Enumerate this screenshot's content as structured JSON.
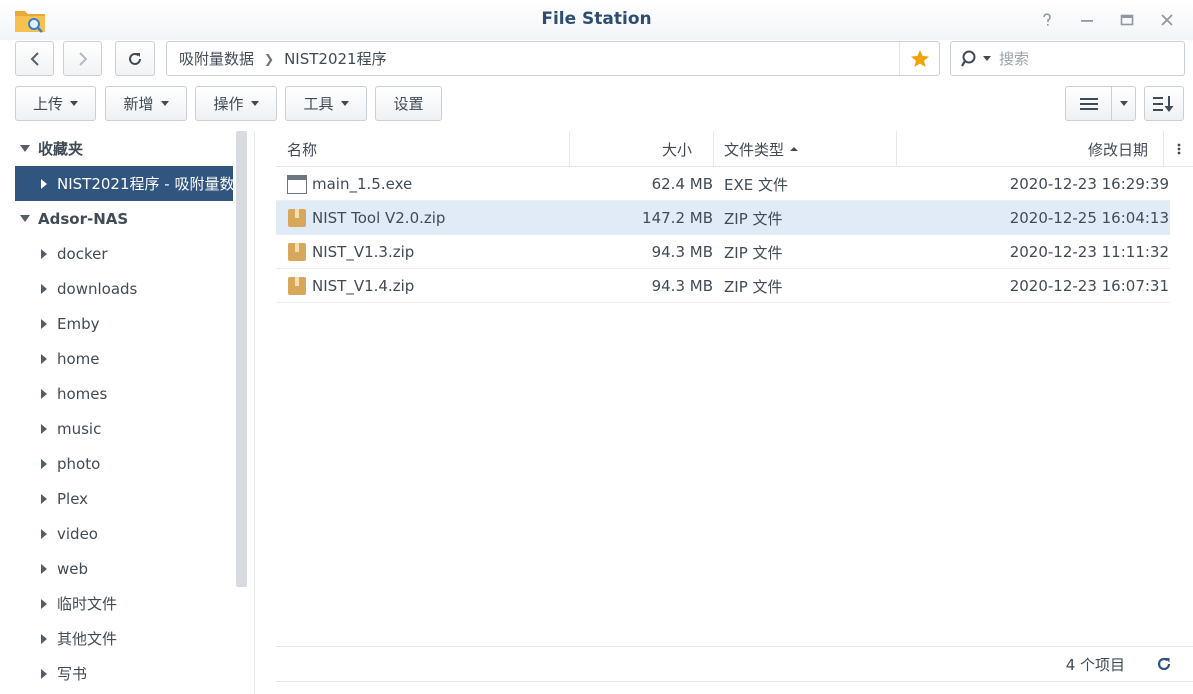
{
  "window": {
    "title": "File Station"
  },
  "nav": {
    "path": [
      "吸附量数据",
      "NIST2021程序"
    ],
    "search_placeholder": "搜索"
  },
  "toolbar": {
    "upload": "上传",
    "create": "新增",
    "action": "操作",
    "tools": "工具",
    "settings": "设置"
  },
  "sidebar": {
    "favorites_label": "收藏夹",
    "favorites": [
      "NIST2021程序 - 吸附量数"
    ],
    "nas_label": "Adsor-NAS",
    "folders": [
      "docker",
      "downloads",
      "Emby",
      "home",
      "homes",
      "music",
      "photo",
      "Plex",
      "video",
      "web",
      "临时文件",
      "其他文件",
      "写书"
    ]
  },
  "list": {
    "columns": {
      "name": "名称",
      "size": "大小",
      "type": "文件类型",
      "modified": "修改日期"
    },
    "files": [
      {
        "name": "main_1.5.exe",
        "size": "62.4 MB",
        "type": "EXE 文件",
        "modified": "2020-12-23 16:29:39",
        "icon": "exe-icon"
      },
      {
        "name": "NIST Tool V2.0.zip",
        "size": "147.2 MB",
        "type": "ZIP 文件",
        "modified": "2020-12-25 16:04:13",
        "icon": "zip-icon"
      },
      {
        "name": "NIST_V1.3.zip",
        "size": "94.3 MB",
        "type": "ZIP 文件",
        "modified": "2020-12-23 11:11:32",
        "icon": "zip-icon"
      },
      {
        "name": "NIST_V1.4.zip",
        "size": "94.3 MB",
        "type": "ZIP 文件",
        "modified": "2020-12-23 16:07:31",
        "icon": "zip-icon"
      }
    ],
    "item_count": "4 个项目"
  },
  "colors": {
    "selected_nav": "#30557e",
    "selected_row": "#e0ebf7",
    "star": "#f0a30a"
  }
}
